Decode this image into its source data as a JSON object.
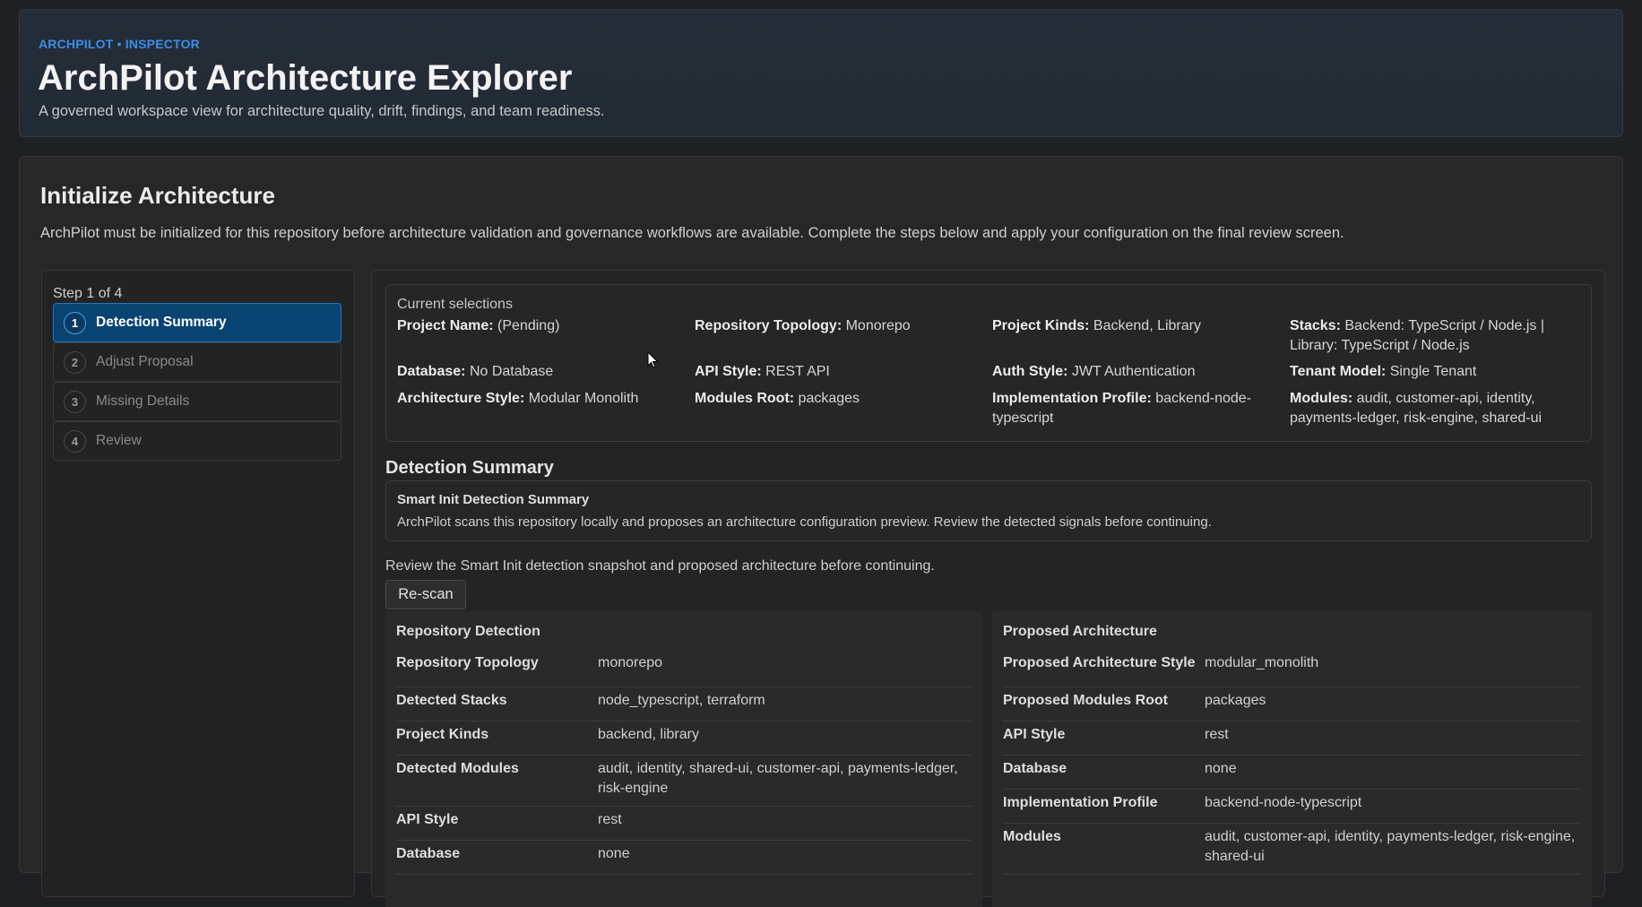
{
  "header": {
    "eyebrow": "ARCHPILOT • INSPECTOR",
    "title": "ArchPilot Architecture Explorer",
    "subtitle": "A governed workspace view for architecture quality, drift, findings, and team readiness."
  },
  "main": {
    "title": "Initialize Architecture",
    "description": "ArchPilot must be initialized for this repository before architecture validation and governance workflows are available. Complete the steps below and apply your configuration on the final review screen."
  },
  "stepper": {
    "counter": "Step 1 of 4",
    "steps": [
      {
        "num": "1",
        "label": "Detection Summary"
      },
      {
        "num": "2",
        "label": "Adjust Proposal"
      },
      {
        "num": "3",
        "label": "Missing Details"
      },
      {
        "num": "4",
        "label": "Review"
      }
    ]
  },
  "selections": {
    "title": "Current selections",
    "items": [
      {
        "key": "Project Name:",
        "value": "(Pending)"
      },
      {
        "key": "Repository Topology:",
        "value": "Monorepo"
      },
      {
        "key": "Project Kinds:",
        "value": "Backend, Library"
      },
      {
        "key": "Stacks:",
        "value": "Backend: TypeScript / Node.js | Library: TypeScript / Node.js"
      },
      {
        "key": "Database:",
        "value": "No Database"
      },
      {
        "key": "API Style:",
        "value": "REST API"
      },
      {
        "key": "Auth Style:",
        "value": "JWT Authentication"
      },
      {
        "key": "Tenant Model:",
        "value": "Single Tenant"
      },
      {
        "key": "Architecture Style:",
        "value": "Modular Monolith"
      },
      {
        "key": "Modules Root:",
        "value": "packages"
      },
      {
        "key": "Implementation Profile:",
        "value": "backend-node-typescript"
      },
      {
        "key": "Modules:",
        "value": "audit, customer-api, identity, payments-ledger, risk-engine, shared-ui"
      }
    ]
  },
  "detection": {
    "heading": "Detection Summary",
    "box_title": "Smart Init Detection Summary",
    "box_text": "ArchPilot scans this repository locally and proposes an architecture configuration preview. Review the detected signals before continuing.",
    "review_note": "Review the Smart Init detection snapshot and proposed architecture before continuing.",
    "rescan_label": "Re-scan"
  },
  "repository_detection": {
    "title": "Repository Detection",
    "rows": [
      {
        "key": "Repository Topology",
        "value": "monorepo"
      },
      {
        "key": "Detected Stacks",
        "value": "node_typescript, terraform"
      },
      {
        "key": "Project Kinds",
        "value": "backend, library"
      },
      {
        "key": "Detected Modules",
        "value": "audit, identity, shared-ui, customer-api, payments-ledger, risk-engine"
      },
      {
        "key": "API Style",
        "value": "rest"
      },
      {
        "key": "Database",
        "value": "none"
      }
    ]
  },
  "proposed_architecture": {
    "title": "Proposed Architecture",
    "rows": [
      {
        "key": "Proposed Architecture Style",
        "value": "modular_monolith"
      },
      {
        "key": "Proposed Modules Root",
        "value": "packages"
      },
      {
        "key": "API Style",
        "value": "rest"
      },
      {
        "key": "Database",
        "value": "none"
      },
      {
        "key": "Implementation Profile",
        "value": "backend-node-typescript"
      },
      {
        "key": "Modules",
        "value": "audit, customer-api, identity, payments-ledger, risk-engine, shared-ui"
      }
    ]
  },
  "colors": {
    "accent": "#3b8eea",
    "active_step_bg": "#084372",
    "background": "#1f2023"
  }
}
